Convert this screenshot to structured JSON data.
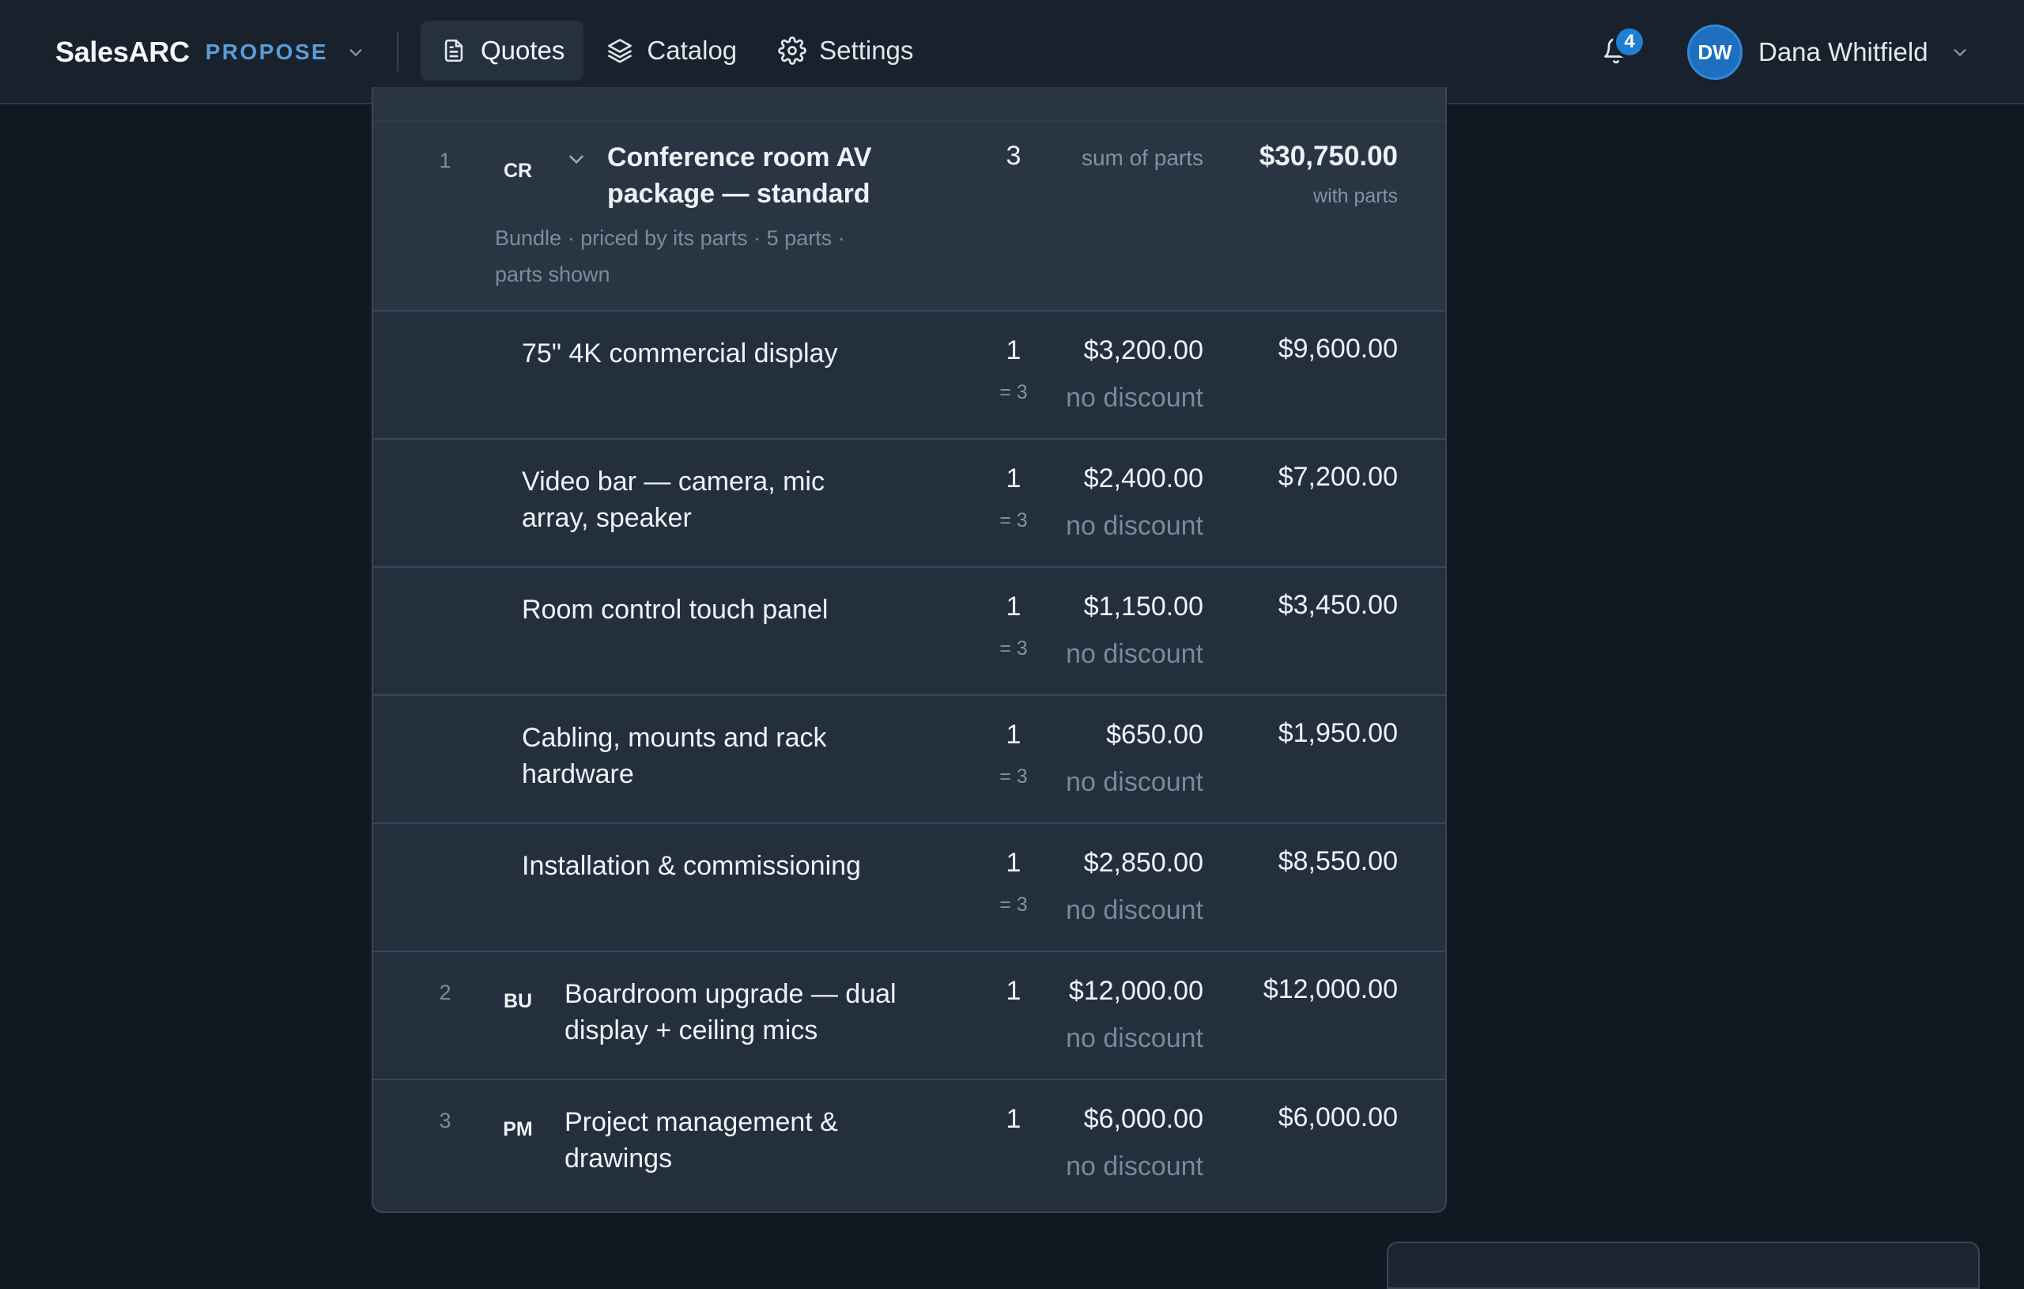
{
  "app": {
    "name": "SalesARC",
    "module": "PROPOSE"
  },
  "nav": {
    "items": [
      {
        "label": "Quotes",
        "icon": "document-icon",
        "active": true
      },
      {
        "label": "Catalog",
        "icon": "layers-icon",
        "active": false
      },
      {
        "label": "Settings",
        "icon": "gear-icon",
        "active": false
      }
    ]
  },
  "notifications": {
    "count": "4"
  },
  "user": {
    "initials": "DW",
    "name": "Dana Whitfield"
  },
  "colors": {
    "accent": "#1f7fd1",
    "module": "#5b9bd8",
    "background": "#111821",
    "card": "#242f3d"
  },
  "lines": {
    "bundle": {
      "index": "1",
      "code": "CR",
      "name": "Conference room AV package — standard",
      "meta": "Bundle · priced by its parts · 5 parts · parts shown",
      "qty": "3",
      "price_label": "sum of parts",
      "total": "$30,750.00",
      "total_note": "with parts"
    },
    "parts": [
      {
        "name": "75\" 4K commercial display",
        "qty": "1",
        "qty_sub": "= 3",
        "price": "$3,200.00",
        "discount": "no discount",
        "total": "$9,600.00"
      },
      {
        "name": "Video bar — camera, mic array, speaker",
        "qty": "1",
        "qty_sub": "= 3",
        "price": "$2,400.00",
        "discount": "no discount",
        "total": "$7,200.00"
      },
      {
        "name": "Room control touch panel",
        "qty": "1",
        "qty_sub": "= 3",
        "price": "$1,150.00",
        "discount": "no discount",
        "total": "$3,450.00"
      },
      {
        "name": "Cabling, mounts and rack hardware",
        "qty": "1",
        "qty_sub": "= 3",
        "price": "$650.00",
        "discount": "no discount",
        "total": "$1,950.00"
      },
      {
        "name": "Installation & commissioning",
        "qty": "1",
        "qty_sub": "= 3",
        "price": "$2,850.00",
        "discount": "no discount",
        "total": "$8,550.00"
      }
    ],
    "items": [
      {
        "index": "2",
        "code": "BU",
        "name": "Boardroom upgrade — dual display + ceiling mics",
        "qty": "1",
        "price": "$12,000.00",
        "discount": "no discount",
        "total": "$12,000.00"
      },
      {
        "index": "3",
        "code": "PM",
        "name": "Project management & drawings",
        "qty": "1",
        "price": "$6,000.00",
        "discount": "no discount",
        "total": "$6,000.00"
      }
    ]
  }
}
